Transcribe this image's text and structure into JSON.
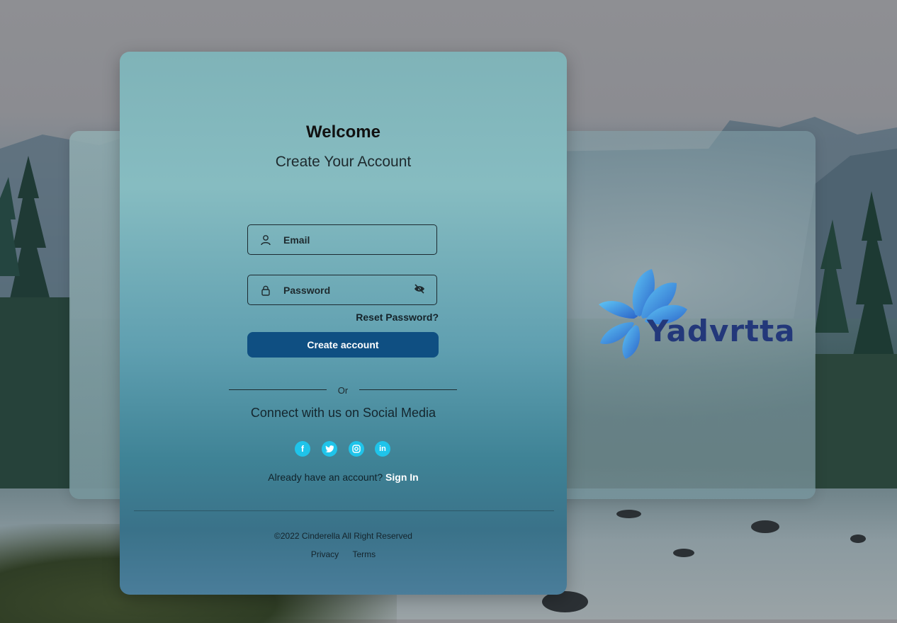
{
  "card": {
    "title": "Welcome",
    "subtitle": "Create Your Account",
    "email_placeholder": "Email",
    "password_placeholder": "Password",
    "reset_link": "Reset Password?",
    "create_button": "Create account",
    "or_divider": "Or",
    "social_heading": "Connect with us on Social Media",
    "social_icons": [
      "facebook-icon",
      "twitter-icon",
      "instagram-icon",
      "linkedin-icon"
    ],
    "signin_prompt": "Already have an account?",
    "signin_link": "Sign In"
  },
  "footer": {
    "copyright": "©2022 Cinderella All Right Reserved",
    "privacy": "Privacy",
    "terms": "Terms"
  },
  "brand": {
    "name": "Yadvrtta"
  },
  "colors": {
    "button": "#0f4f82",
    "social": "#1fc4ea",
    "logo_text": "#23387a"
  }
}
